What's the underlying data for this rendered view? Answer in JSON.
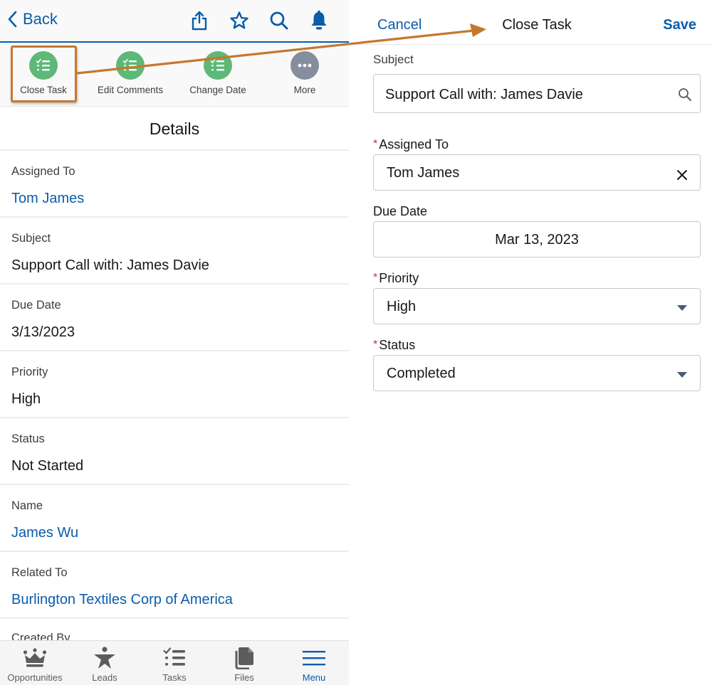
{
  "left_panel": {
    "header": {
      "back_label": "Back",
      "icons": [
        "share-icon",
        "favorite-star-icon",
        "search-icon",
        "notifications-bell-icon"
      ]
    },
    "actions": [
      {
        "label": "Close Task",
        "icon": "task-icon",
        "color": "#5eb877",
        "highlighted": true
      },
      {
        "label": "Edit Comments",
        "icon": "task-icon",
        "color": "#5eb877"
      },
      {
        "label": "Change Date",
        "icon": "task-icon",
        "color": "#5eb877"
      },
      {
        "label": "More",
        "icon": "more-dots-icon",
        "color": "#868e9e"
      }
    ],
    "section_title": "Details",
    "fields": [
      {
        "label": "Assigned To",
        "value": "Tom James",
        "link": true
      },
      {
        "label": "Subject",
        "value": "Support Call with: James Davie",
        "link": false
      },
      {
        "label": "Due Date",
        "value": "3/13/2023",
        "link": false
      },
      {
        "label": "Priority",
        "value": "High",
        "link": false
      },
      {
        "label": "Status",
        "value": "Not Started",
        "link": false
      },
      {
        "label": "Name",
        "value": "James Wu",
        "link": true
      },
      {
        "label": "Related To",
        "value": "Burlington Textiles Corp of America",
        "link": true
      },
      {
        "label": "Created By",
        "value": "",
        "link": false
      }
    ],
    "tabbar": [
      {
        "label": "Opportunities",
        "icon": "crown-icon"
      },
      {
        "label": "Leads",
        "icon": "person-star-icon"
      },
      {
        "label": "Tasks",
        "icon": "task-list-icon"
      },
      {
        "label": "Files",
        "icon": "files-icon"
      },
      {
        "label": "Menu",
        "icon": "menu-hamburger-icon",
        "active": true
      }
    ]
  },
  "right_panel": {
    "header": {
      "cancel_label": "Cancel",
      "title": "Close Task",
      "save_label": "Save"
    },
    "form": {
      "subject": {
        "label": "Subject",
        "value": "Support Call with: James Davie",
        "required": false
      },
      "assigned_to": {
        "label": "Assigned To",
        "value": "Tom James",
        "required": true
      },
      "due_date": {
        "label": "Due Date",
        "value": "Mar 13, 2023",
        "required": false
      },
      "priority": {
        "label": "Priority",
        "value": "High",
        "required": true
      },
      "status": {
        "label": "Status",
        "value": "Completed",
        "required": true
      }
    },
    "required_marker": "*"
  },
  "colors": {
    "brand_blue": "#0b5cab",
    "action_green": "#5eb877",
    "more_gray": "#868e9e",
    "annotation_orange": "#c5782c",
    "required_red": "#c23934"
  }
}
